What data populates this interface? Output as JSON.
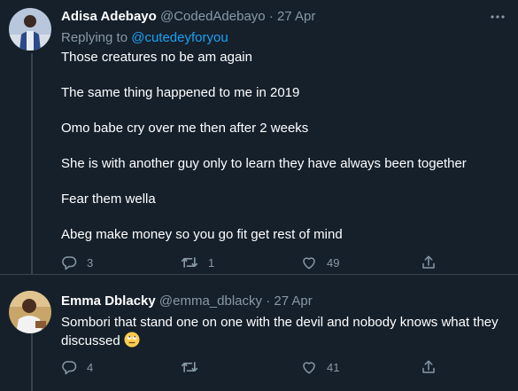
{
  "tweets": [
    {
      "name": "Adisa Adebayo",
      "handle": "@CodedAdebayo",
      "separator": "·",
      "date": "27 Apr",
      "replying_prefix": "Replying to",
      "replying_to": "@cutedeyforyou",
      "paragraphs": [
        "Those creatures no be am again",
        "The same thing happened to me in 2019",
        "Omo babe cry over me then after 2 weeks",
        "She is with another guy only to learn they have always been together",
        "Fear them wella",
        "Abeg make money so you go fit get rest of mind"
      ],
      "replies": "3",
      "retweets": "1",
      "likes": "49"
    },
    {
      "name": "Emma Dblacky",
      "handle": "@emma_dblacky",
      "separator": "·",
      "date": "27 Apr",
      "text": "Sombori that stand one on one with the devil and nobody knows what they discussed",
      "emoji": "rolling-eyes-emoji",
      "replies": "4",
      "retweets": "",
      "likes": "41"
    }
  ],
  "icons": {
    "more": "more-horizontal-icon",
    "reply": "reply-icon",
    "retweet": "retweet-icon",
    "like": "heart-icon",
    "share": "share-icon"
  },
  "colors": {
    "background": "#15202b",
    "secondary_text": "#8899a6",
    "link": "#1da1f2",
    "divider": "#38444d"
  }
}
